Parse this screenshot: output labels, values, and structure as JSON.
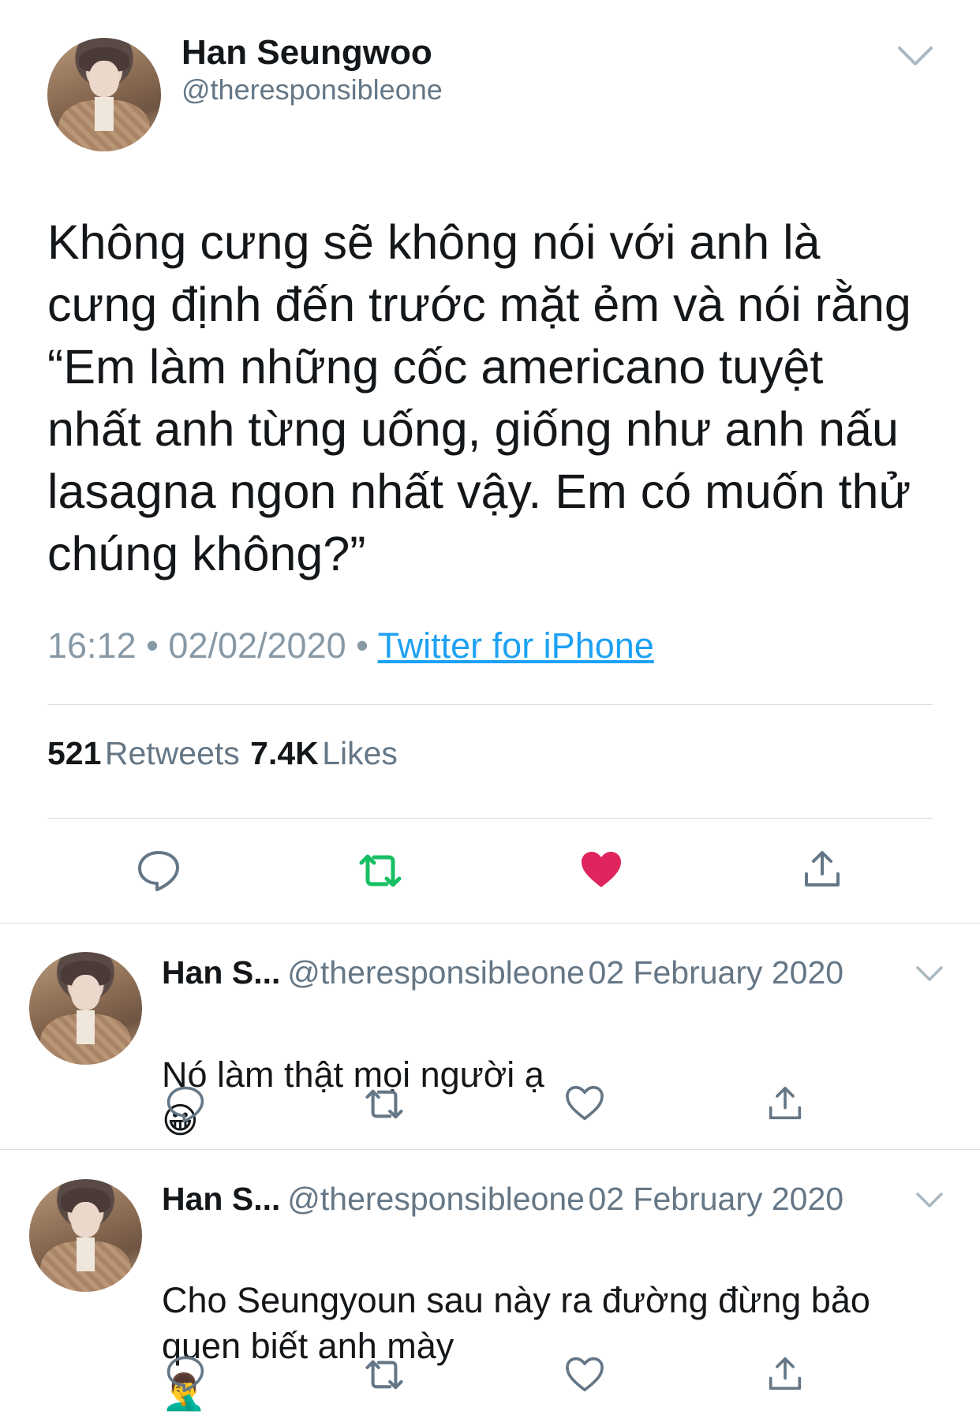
{
  "tweet": {
    "author_name": "Han Seungwoo",
    "author_handle": "@theresponsibleone",
    "text": "Không cưng sẽ không nói với anh là\ncưng định đến trước mặt ẻm và nói rằng\n“Em làm những cốc americano tuyệt\nnhất anh từng uống, giống như anh nấu\nlasagna ngon nhất vậy. Em có muốn thử\nchúng không?”",
    "time": "16:12",
    "date": "02/02/2020",
    "separator": "•",
    "source": "Twitter for iPhone",
    "retweets_count": "521",
    "retweets_label": "Retweets",
    "likes_count": "7.4K",
    "likes_label": "Likes"
  },
  "replies": [
    {
      "name": "Han S...",
      "handle": "@theresponsibleone",
      "date": "02 February 2020",
      "text": "Nó làm thật mọi người ạ",
      "emoji": "😀"
    },
    {
      "name": "Han S...",
      "handle": "@theresponsibleone",
      "date": "02 February 2020",
      "text": "Cho Seungyoun sau này ra đường đừng bảo\nquen biết anh mày",
      "emoji": "🤦‍♂️"
    }
  ],
  "icons": {
    "reply": "speech-bubble-icon",
    "retweet": "retweet-icon",
    "like": "heart-icon",
    "share": "share-icon",
    "more": "chevron-down-icon"
  },
  "colors": {
    "retweet_active": "#17bf63",
    "like_active": "#e0245e",
    "link": "#1da1f2",
    "action_gray": "#657786"
  }
}
